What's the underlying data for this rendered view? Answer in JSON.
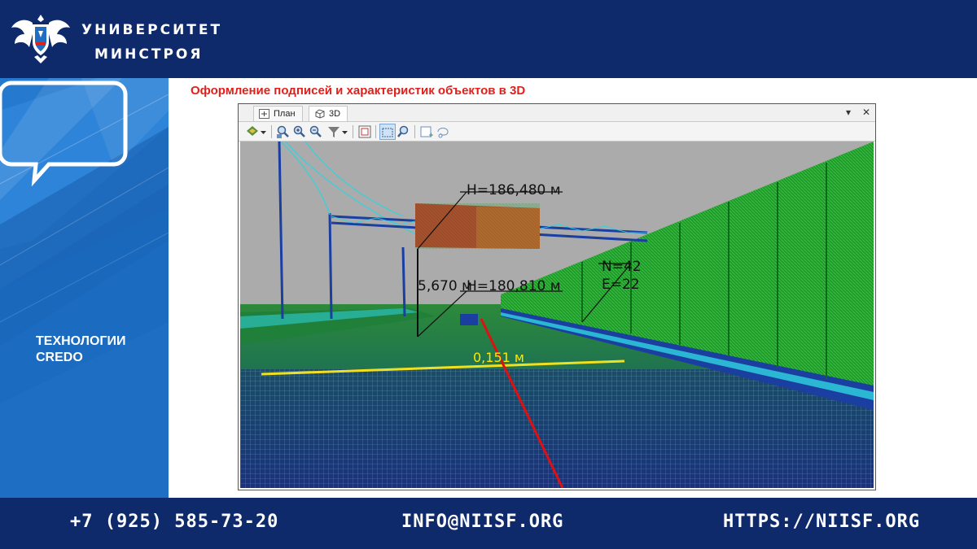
{
  "header": {
    "org_line1": "УНИВЕРСИТЕТ",
    "org_line2": "МИНСТРОЯ",
    "emblem": "eagle-emblem-icon"
  },
  "side": {
    "logo_line1": "ТЕХНОЛОГИИ",
    "logo_line2": "CREDO"
  },
  "slide_title": "Оформление подписей и характеристик объектов в 3D",
  "app": {
    "tabs": [
      {
        "label": "План",
        "icon": "plan-icon"
      },
      {
        "label": "3D",
        "icon": "cube-3d-icon",
        "active": true
      }
    ],
    "window_controls": [
      "▾",
      "✕"
    ],
    "toolbar_icons": [
      "layers-icon",
      "chevron-down-icon",
      "zoom-extent-icon",
      "zoom-in-icon",
      "zoom-out-icon",
      "filter-icon",
      "chevron-down-icon",
      "frame-icon",
      "select-region-icon",
      "zoom-select-icon",
      "add-point-icon",
      "lasso-icon"
    ]
  },
  "viewport": {
    "labels": {
      "h_sign": "H=186,480 м",
      "h_base": "H=180,810 м",
      "height_diff": "5,670 м",
      "north": "N=42",
      "east": "E=22",
      "width": "0,151 м"
    },
    "colors": {
      "sky": "#ababab",
      "points_green": "#1f9a2a",
      "points_blue": "#1a3fa0",
      "points_cyan": "#2fd4e0",
      "sign_red": "#c8322a",
      "measure_red": "#e01010",
      "measure_yellow": "#f0e020"
    }
  },
  "footer": {
    "phone": "+7 (925) 585-73-20",
    "email": "INFO@NIISF.ORG",
    "url": "HTTPS://NIISF.ORG"
  }
}
